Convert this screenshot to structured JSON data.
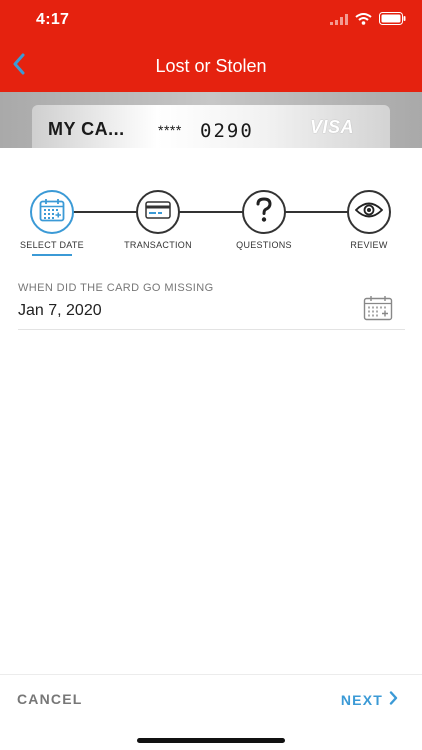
{
  "status_bar": {
    "time": "4:17",
    "icons": [
      "signal-icon",
      "wifi-icon",
      "battery-icon"
    ]
  },
  "nav": {
    "title": "Lost or Stolen",
    "back_icon": "chevron-left-icon"
  },
  "card": {
    "name": "MY CA...",
    "masked": "****",
    "last_digits": "0290",
    "brand": "VISA"
  },
  "steps": [
    {
      "label": "SELECT DATE",
      "icon": "calendar-icon",
      "active": true
    },
    {
      "label": "TRANSACTION",
      "icon": "credit-card-icon",
      "active": false
    },
    {
      "label": "QUESTIONS",
      "icon": "question-icon",
      "active": false
    },
    {
      "label": "REVIEW",
      "icon": "eye-icon",
      "active": false
    }
  ],
  "field": {
    "label": "WHEN DID THE CARD GO MISSING",
    "value": "Jan 7, 2020",
    "icon": "calendar-icon"
  },
  "footer": {
    "cancel_label": "CANCEL",
    "next_label": "NEXT"
  },
  "colors": {
    "header": "#e5220f",
    "accent": "#3b9ad6",
    "text_muted": "#777777"
  }
}
